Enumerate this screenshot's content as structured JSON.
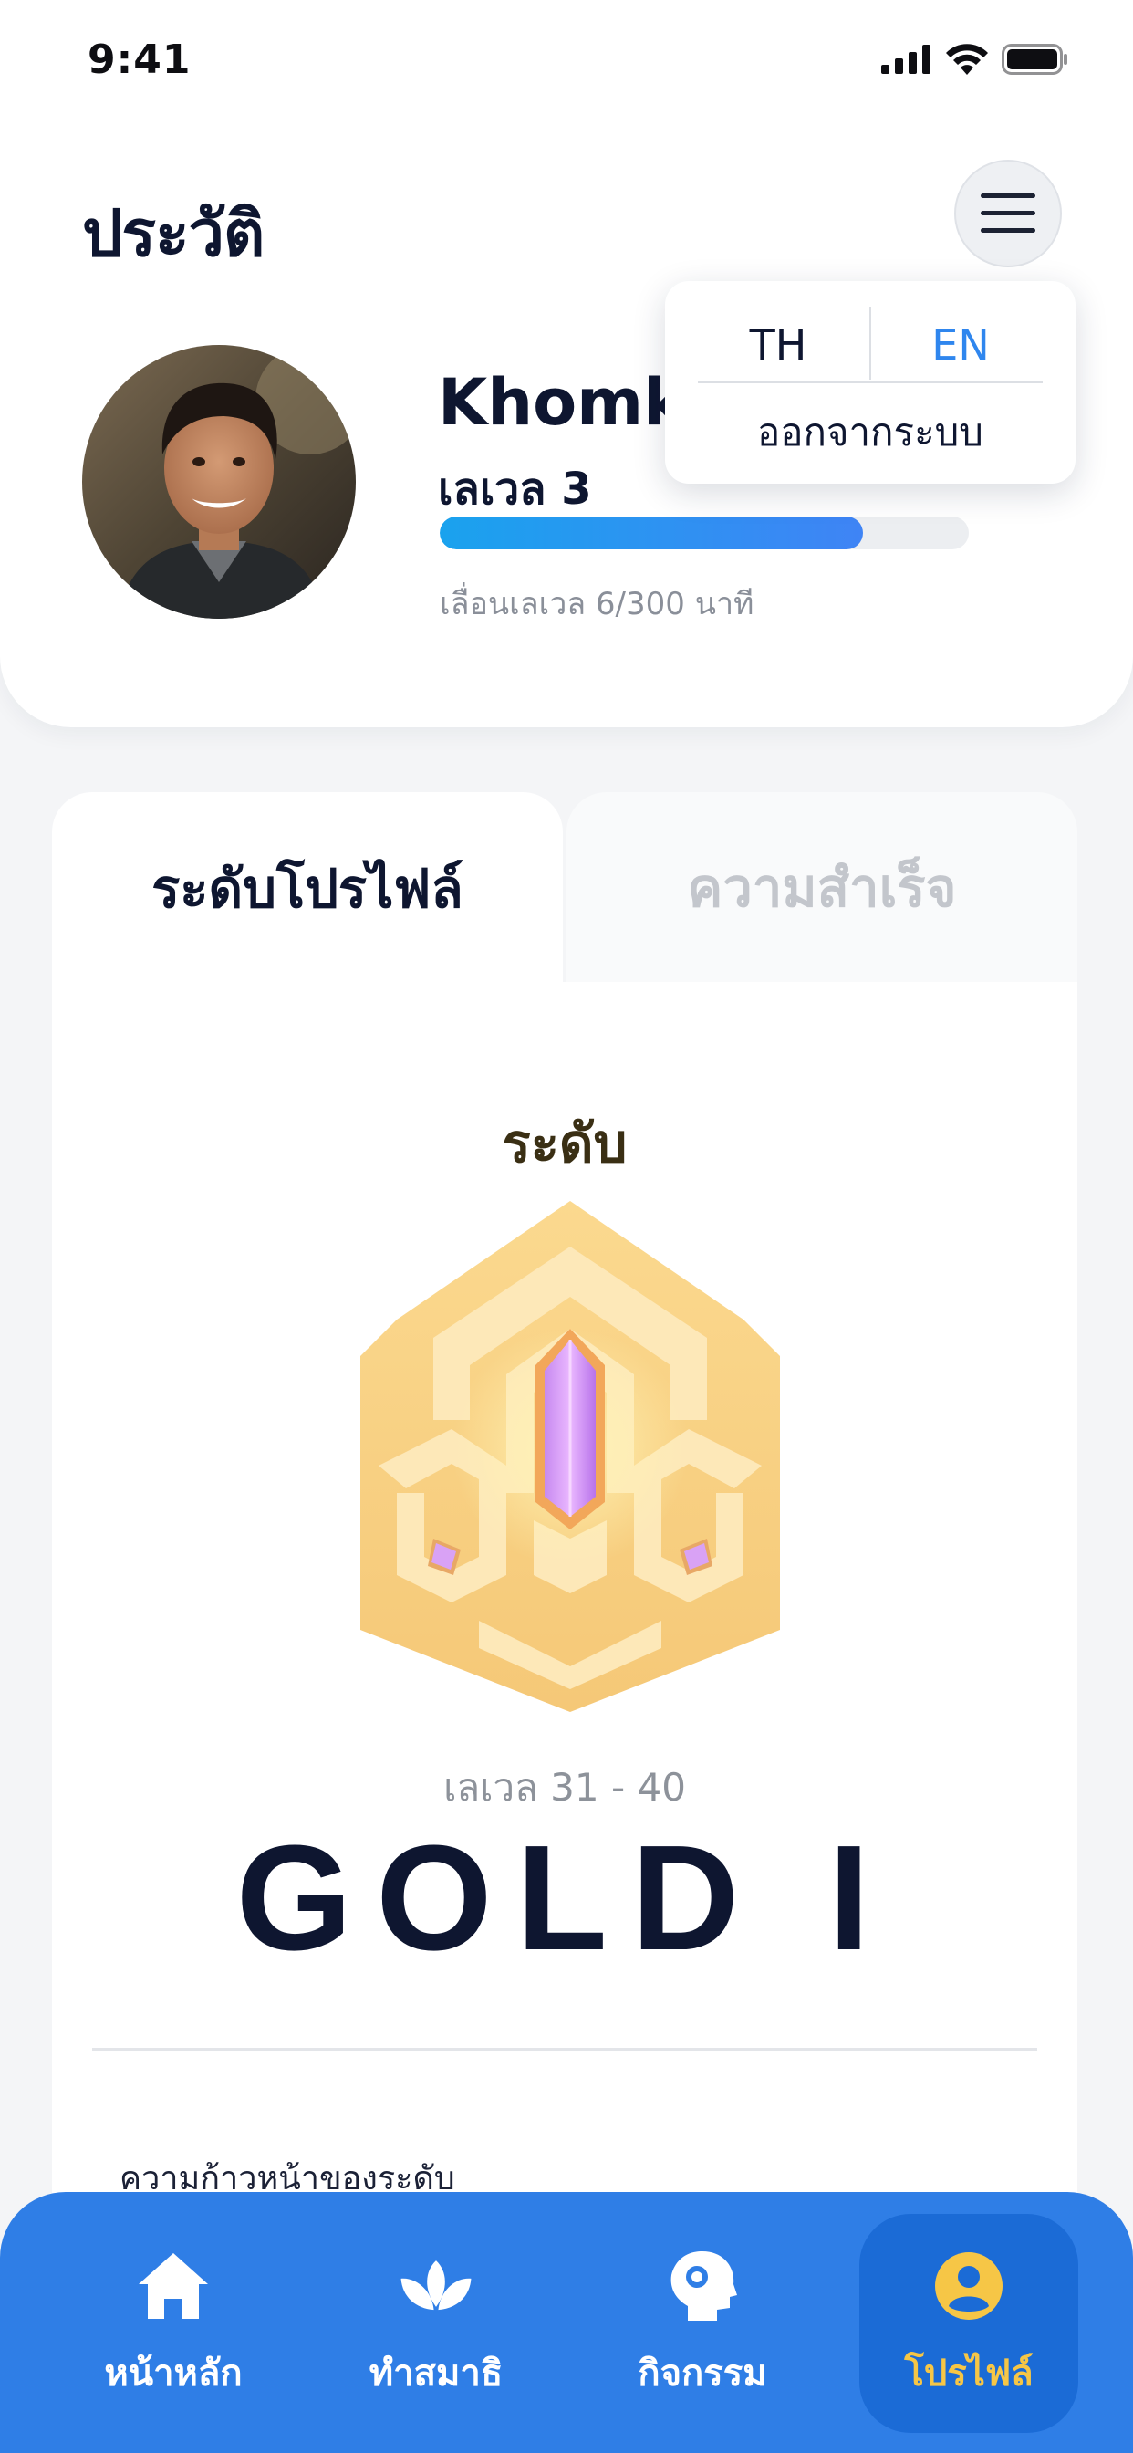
{
  "status_bar": {
    "time": "9:41"
  },
  "header": {
    "title": "ประวัติ",
    "menu_icon": "hamburger-icon"
  },
  "profile": {
    "name": "Khomkr",
    "level": "เลเวล 3",
    "progress_fraction": 0.8,
    "level_hint": "เลื่อนเลเวล 6/300 นาที"
  },
  "dropdown": {
    "lang_th": "TH",
    "lang_en": "EN",
    "selected_language": "EN",
    "logout": "ออกจากระบบ"
  },
  "tabs": [
    {
      "label": "ระดับโปรไฟล์",
      "active": true
    },
    {
      "label": "ความสำเร็จ",
      "active": false
    }
  ],
  "rank": {
    "heading": "ระดับ",
    "badge_icon": "gold-gem-badge-icon",
    "level_range": "เลเวล 31 - 40",
    "name": "GOLD I",
    "progress_label": "ความก้าวหน้าของระดับ"
  },
  "bottom_nav": [
    {
      "label": "หน้าหลัก",
      "icon": "home-icon",
      "active": false
    },
    {
      "label": "ทำสมาธิ",
      "icon": "lotus-icon",
      "active": false
    },
    {
      "label": "กิจกรรม",
      "icon": "brain-head-icon",
      "active": false
    },
    {
      "label": "โปรไฟล์",
      "icon": "user-circle-icon",
      "active": true
    }
  ],
  "colors": {
    "accent_blue": "#2f7ee6",
    "progress_start": "#1aa2ee",
    "progress_end": "#3f84f5",
    "active_nav": "#f6c646",
    "gold": "#f7d48a"
  }
}
